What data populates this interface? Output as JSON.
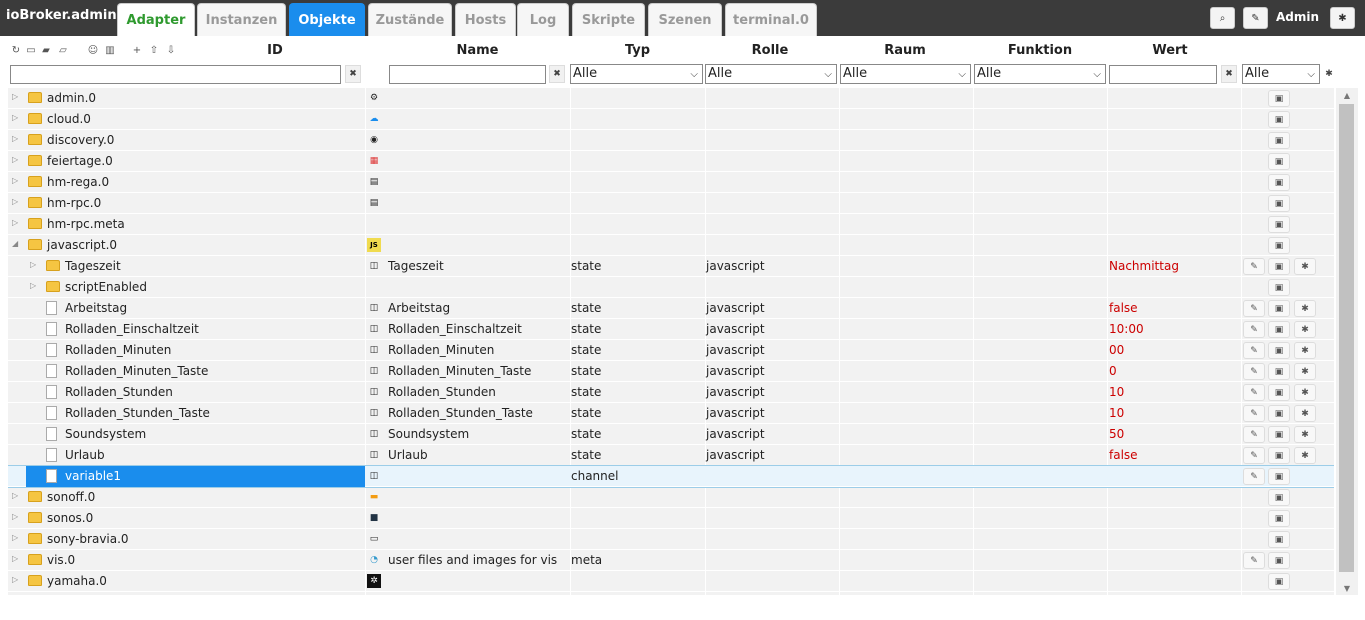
{
  "app_title": "ioBroker.admin",
  "tabs": [
    {
      "label": "Adapter"
    },
    {
      "label": "Instanzen"
    },
    {
      "label": "Objekte"
    },
    {
      "label": "Zustände"
    },
    {
      "label": "Hosts"
    },
    {
      "label": "Log"
    },
    {
      "label": "Skripte"
    },
    {
      "label": "Szenen"
    },
    {
      "label": "terminal.0"
    }
  ],
  "active_tab": "Objekte",
  "user": "Admin",
  "columns": {
    "id": "ID",
    "name": "Name",
    "type": "Typ",
    "role": "Rolle",
    "room": "Raum",
    "function": "Funktion",
    "value": "Wert"
  },
  "filters": {
    "id": "",
    "name": "",
    "type": "Alle",
    "role": "Alle",
    "room": "Alle",
    "function": "Alle",
    "value": "",
    "extra": "Alle"
  },
  "rows": [
    {
      "id": "admin.0",
      "name": "",
      "type": "",
      "role": "",
      "value": "",
      "icon": "gear-icon"
    },
    {
      "id": "cloud.0",
      "name": "",
      "type": "",
      "role": "",
      "value": "",
      "icon": "cloud-icon"
    },
    {
      "id": "discovery.0",
      "name": "",
      "type": "",
      "role": "",
      "value": "",
      "icon": "binoculars-icon"
    },
    {
      "id": "feiertage.0",
      "name": "",
      "type": "",
      "role": "",
      "value": "",
      "icon": "calendar-icon"
    },
    {
      "id": "hm-rega.0",
      "name": "",
      "type": "",
      "role": "",
      "value": "",
      "icon": "homematic-icon"
    },
    {
      "id": "hm-rpc.0",
      "name": "",
      "type": "",
      "role": "",
      "value": "",
      "icon": "homematic-icon"
    },
    {
      "id": "hm-rpc.meta",
      "name": "",
      "type": "",
      "role": "",
      "value": "",
      "icon": ""
    },
    {
      "id": "javascript.0",
      "name": "",
      "type": "",
      "role": "",
      "value": "",
      "icon": "javascript-icon"
    },
    {
      "id": "Tageszeit",
      "name": "Tageszeit",
      "type": "state",
      "role": "javascript",
      "value": "Nachmittag",
      "icon": "state-icon"
    },
    {
      "id": "scriptEnabled",
      "name": "",
      "type": "",
      "role": "",
      "value": "",
      "icon": ""
    },
    {
      "id": "Arbeitstag",
      "name": "Arbeitstag",
      "type": "state",
      "role": "javascript",
      "value": "false",
      "icon": "state-icon"
    },
    {
      "id": "Rolladen_Einschaltzeit",
      "name": "Rolladen_Einschaltzeit",
      "type": "state",
      "role": "javascript",
      "value": "10:00",
      "icon": "state-icon"
    },
    {
      "id": "Rolladen_Minuten",
      "name": "Rolladen_Minuten",
      "type": "state",
      "role": "javascript",
      "value": "00",
      "icon": "state-icon"
    },
    {
      "id": "Rolladen_Minuten_Taste",
      "name": "Rolladen_Minuten_Taste",
      "type": "state",
      "role": "javascript",
      "value": "0",
      "icon": "state-icon"
    },
    {
      "id": "Rolladen_Stunden",
      "name": "Rolladen_Stunden",
      "type": "state",
      "role": "javascript",
      "value": "10",
      "icon": "state-icon"
    },
    {
      "id": "Rolladen_Stunden_Taste",
      "name": "Rolladen_Stunden_Taste",
      "type": "state",
      "role": "javascript",
      "value": "10",
      "icon": "state-icon"
    },
    {
      "id": "Soundsystem",
      "name": "Soundsystem",
      "type": "state",
      "role": "javascript",
      "value": "50",
      "icon": "state-icon"
    },
    {
      "id": "Urlaub",
      "name": "Urlaub",
      "type": "state",
      "role": "javascript",
      "value": "false",
      "icon": "state-icon"
    },
    {
      "id": "variable1",
      "name": "",
      "type": "channel",
      "role": "",
      "value": "",
      "icon": "channel-icon"
    },
    {
      "id": "sonoff.0",
      "name": "",
      "type": "",
      "role": "",
      "value": "",
      "icon": "sonoff-icon"
    },
    {
      "id": "sonos.0",
      "name": "",
      "type": "",
      "role": "",
      "value": "",
      "icon": "sonos-icon"
    },
    {
      "id": "sony-bravia.0",
      "name": "",
      "type": "",
      "role": "",
      "value": "",
      "icon": "sony-icon"
    },
    {
      "id": "vis.0",
      "name": "user files and images for vis",
      "type": "meta",
      "role": "",
      "value": "",
      "icon": "vis-icon"
    },
    {
      "id": "yamaha.0",
      "name": "",
      "type": "",
      "role": "",
      "value": "",
      "icon": "yamaha-icon"
    }
  ]
}
